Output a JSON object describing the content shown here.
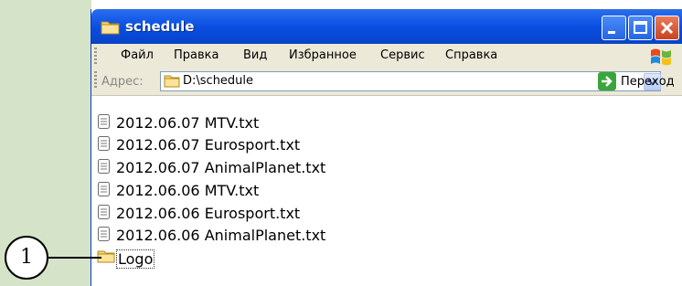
{
  "window": {
    "title": "schedule"
  },
  "menu": {
    "items": [
      "Файл",
      "Правка",
      "Вид",
      "Избранное",
      "Сервис",
      "Справка"
    ]
  },
  "address": {
    "label": "Адрес:",
    "value": "D:\\schedule",
    "go_label": "Переход"
  },
  "files": [
    {
      "name": "2012.06.07 MTV.txt",
      "type": "text-file-icon"
    },
    {
      "name": "2012.06.07 Eurosport.txt",
      "type": "text-file-icon"
    },
    {
      "name": "2012.06.07 AnimalPlanet.txt",
      "type": "text-file-icon"
    },
    {
      "name": "2012.06.06 MTV.txt",
      "type": "text-file-icon"
    },
    {
      "name": "2012.06.06 Eurosport.txt",
      "type": "text-file-icon"
    },
    {
      "name": "2012.06.06 AnimalPlanet.txt",
      "type": "text-file-icon"
    },
    {
      "name": "Logo",
      "type": "folder-icon"
    }
  ],
  "callout": {
    "number": "1"
  },
  "colors": {
    "titlebar": "#0a4fe0",
    "side_panel": "#d5e3c9",
    "chrome": "#ece9d8"
  }
}
